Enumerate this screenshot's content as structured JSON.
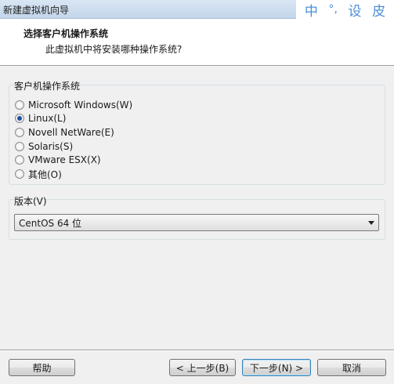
{
  "window": {
    "title": "新建虚拟机向导"
  },
  "ime": {
    "items": [
      "中",
      "°,",
      "设",
      "皮"
    ]
  },
  "header": {
    "title": "选择客户机操作系统",
    "subtitle": "此虚拟机中将安装哪种操作系统?"
  },
  "os_group": {
    "legend": "客户机操作系统",
    "options": [
      {
        "label": "Microsoft Windows(W)",
        "checked": false
      },
      {
        "label": "Linux(L)",
        "checked": true
      },
      {
        "label": "Novell NetWare(E)",
        "checked": false
      },
      {
        "label": "Solaris(S)",
        "checked": false
      },
      {
        "label": "VMware ESX(X)",
        "checked": false
      },
      {
        "label": "其他(O)",
        "checked": false
      }
    ]
  },
  "version_group": {
    "legend": "版本(V)",
    "selected": "CentOS 64 位"
  },
  "buttons": {
    "help": "帮助",
    "back": "< 上一步(B)",
    "next": "下一步(N) >",
    "cancel": "取消"
  },
  "colors": {
    "radio_dot": "#1f4f9c",
    "ime_text": "#4a8fd6",
    "default_button_border": "#3c7fb1"
  }
}
